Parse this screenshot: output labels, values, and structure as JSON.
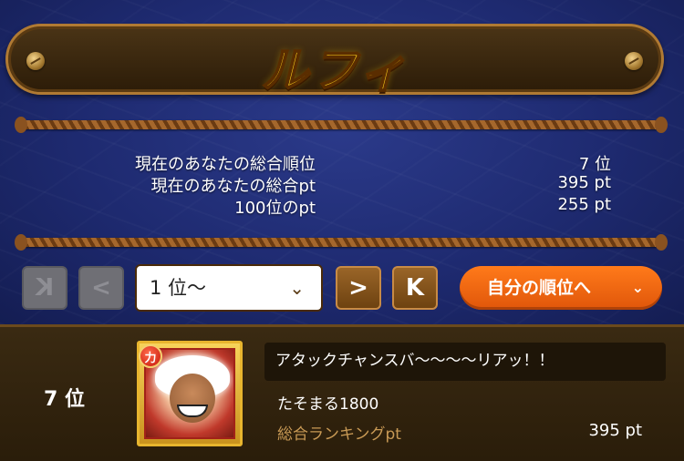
{
  "banner": {
    "title": "ルフィ"
  },
  "stats": [
    {
      "label": "現在のあなたの総合順位",
      "value": "7 位"
    },
    {
      "label": "現在のあなたの総合pt",
      "value": "395 pt"
    },
    {
      "label": "100位のpt",
      "value": "255 pt"
    }
  ],
  "controls": {
    "first_icon": "K",
    "prev_icon": "<",
    "next_icon": ">",
    "last_icon": "K",
    "select_value": "1 位〜",
    "select_chevron": "⌄",
    "my_rank_label": "自分の順位へ",
    "my_rank_chevron": "⌄"
  },
  "entry": {
    "rank": "7 位",
    "type_badge": "力",
    "comment": "アタックチャンスバ〜〜〜〜リアッ！！",
    "player_name": "たそまる1800",
    "pt_label": "総合ランキングpt",
    "pt_value": "395 pt"
  },
  "colors": {
    "background": "#1d2a6b",
    "title": "#ffd21c",
    "accent_button": "#ff7a1a",
    "panel": "#3a2a12"
  }
}
